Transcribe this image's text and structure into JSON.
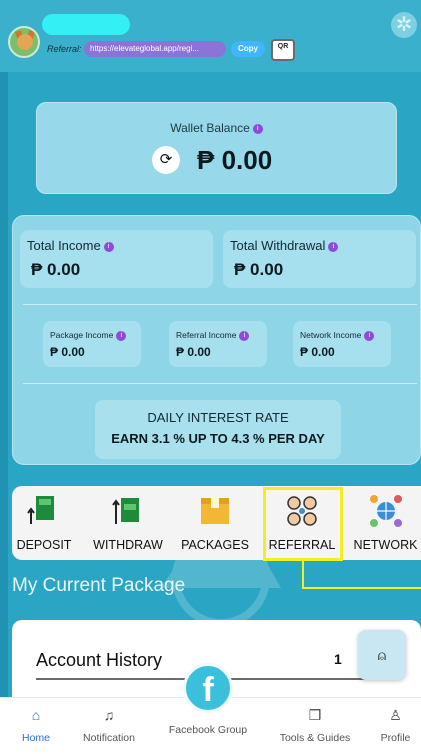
{
  "header": {
    "referral_label": "Referral:",
    "referral_link": "https://elevateglobal.app/regi...",
    "copy_label": "Copy",
    "qr_label": "QR"
  },
  "wallet": {
    "title": "Wallet Balance",
    "amount": "₱ 0.00"
  },
  "stats": {
    "total_income_label": "Total Income",
    "total_income_value": "₱ 0.00",
    "total_withdrawal_label": "Total Withdrawal",
    "total_withdrawal_value": "₱ 0.00",
    "package_income_label": "Package Income",
    "package_income_value": "₱ 0.00",
    "referral_income_label": "Referral Income",
    "referral_income_value": "₱ 0.00",
    "network_income_label": "Network Income",
    "network_income_value": "₱ 0.00"
  },
  "rate": {
    "title": "DAILY INTEREST RATE",
    "subtitle": "EARN 3.1 % UP TO 4.3 % PER DAY"
  },
  "actions": [
    {
      "label": "DEPOSIT",
      "icon": "deposit-icon"
    },
    {
      "label": "WITHDRAW",
      "icon": "withdraw-icon"
    },
    {
      "label": "PACKAGES",
      "icon": "packages-icon"
    },
    {
      "label": "REFERRAL",
      "icon": "referral-icon"
    },
    {
      "label": "NETWORK",
      "icon": "network-icon"
    }
  ],
  "section": {
    "current_package_title": "My Current Package"
  },
  "history": {
    "title": "Account History",
    "count": "1"
  },
  "nav": {
    "home": "Home",
    "notification": "Notification",
    "facebook": "Facebook Group",
    "tools": "Tools & Guides",
    "profile": "Profile"
  },
  "colors": {
    "background": "#2aa6c4",
    "highlight": "#f2ee22",
    "nav_active": "#2b6fd6"
  }
}
